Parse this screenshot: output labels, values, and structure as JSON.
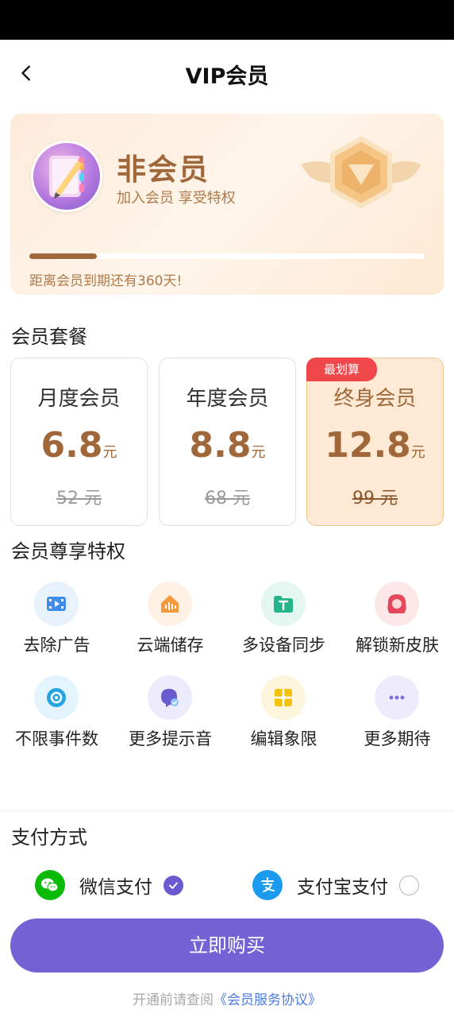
{
  "header": {
    "title": "VIP会员",
    "back_icon": "chevron-left-icon"
  },
  "member_card": {
    "status": "非会员",
    "subtitle": "加入会员 享受特权",
    "progress_fraction": 0.17,
    "expire_text": "距离会员到期还有360天!",
    "colors": {
      "accent": "#a0683a",
      "background": "#fdebd9"
    }
  },
  "plans_section": {
    "title": "会员套餐",
    "plans": [
      {
        "name": "月度会员",
        "price": "6.8",
        "unit": "元",
        "original": "52 元",
        "tag": ""
      },
      {
        "name": "年度会员",
        "price": "8.8",
        "unit": "元",
        "original": "68 元",
        "tag": ""
      },
      {
        "name": "终身会员",
        "price": "12.8",
        "unit": "元",
        "original": "99 元",
        "tag": "最划算"
      }
    ],
    "selected_index": 2
  },
  "privileges_section": {
    "title": "会员尊享特权",
    "items": [
      {
        "label": "去除广告",
        "icon": "video-icon",
        "color": "#3f8de8"
      },
      {
        "label": "云端储存",
        "icon": "cloud-house-icon",
        "color": "#f39a3c"
      },
      {
        "label": "多设备同步",
        "icon": "folder-text-icon",
        "color": "#23b48a"
      },
      {
        "label": "解锁新皮肤",
        "icon": "hair-face-icon",
        "color": "#e5485a"
      },
      {
        "label": "不限事件数",
        "icon": "lens-icon",
        "color": "#27a5e0"
      },
      {
        "label": "更多提示音",
        "icon": "sound-icon",
        "color": "#6a5ad0"
      },
      {
        "label": "编辑象限",
        "icon": "grid-icon",
        "color": "#f4c20d"
      },
      {
        "label": "更多期待",
        "icon": "more-dots-icon",
        "color": "#7b6ee0"
      }
    ]
  },
  "payment": {
    "title": "支付方式",
    "options": [
      {
        "label": "微信支付",
        "icon": "wechat-icon",
        "color": "#09bb07",
        "selected": true
      },
      {
        "label": "支付宝支付",
        "icon": "alipay-icon",
        "color": "#1a9bf0",
        "selected": false
      }
    ]
  },
  "buy_button": {
    "label": "立即购买",
    "color": "#7461d4"
  },
  "agreement": {
    "prefix": "开通前请查阅",
    "link": "《会员服务协议》"
  }
}
